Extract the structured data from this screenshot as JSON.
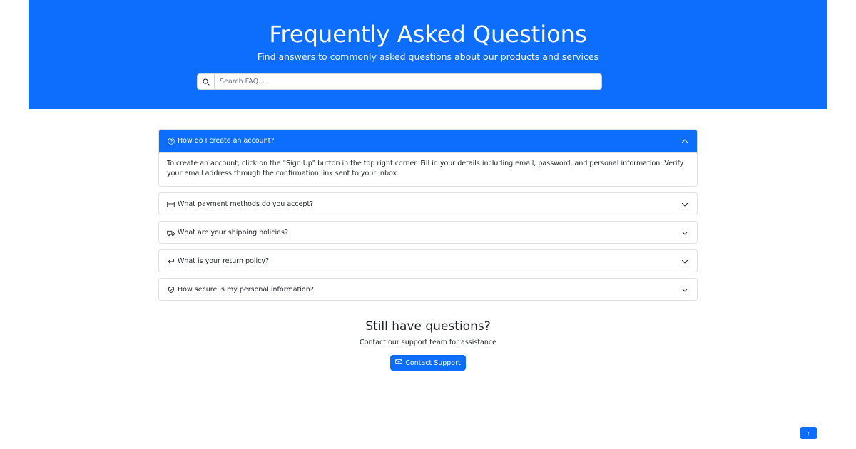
{
  "hero": {
    "title": "Frequently Asked Questions",
    "subtitle": "Find answers to commonly asked questions about our products and services",
    "search_placeholder": "Search FAQ..."
  },
  "faq": {
    "items": [
      {
        "icon": "question-circle-icon",
        "question": "How do I create an account?",
        "answer": "To create an account, click on the \"Sign Up\" button in the top right corner. Fill in your details including email, password, and personal information. Verify your email address through the confirmation link sent to your inbox.",
        "expanded": true
      },
      {
        "icon": "credit-card-icon",
        "question": "What payment methods do you accept?",
        "expanded": false
      },
      {
        "icon": "truck-icon",
        "question": "What are your shipping policies?",
        "expanded": false
      },
      {
        "icon": "return-arrow-icon",
        "question": "What is your return policy?",
        "expanded": false
      },
      {
        "icon": "shield-icon",
        "question": "How secure is my personal information?",
        "expanded": false
      }
    ]
  },
  "contact": {
    "title": "Still have questions?",
    "text": "Contact our support team for assistance",
    "button_label": "Contact Support"
  },
  "back_to_top": {
    "label": "↑"
  },
  "colors": {
    "primary": "#0d6efd",
    "border": "#dee2e6",
    "text": "#212529"
  }
}
